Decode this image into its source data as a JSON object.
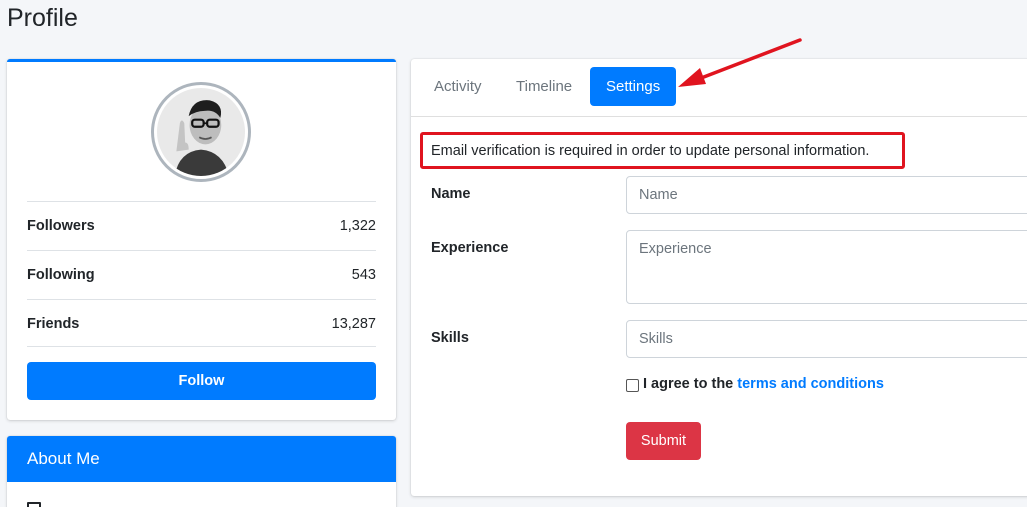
{
  "page": {
    "title": "Profile"
  },
  "profile": {
    "stats": [
      {
        "label": "Followers",
        "value": "1,322"
      },
      {
        "label": "Following",
        "value": "543"
      },
      {
        "label": "Friends",
        "value": "13,287"
      }
    ],
    "follow_label": "Follow"
  },
  "about": {
    "title": "About Me"
  },
  "tabs": [
    {
      "label": "Activity",
      "active": false
    },
    {
      "label": "Timeline",
      "active": false
    },
    {
      "label": "Settings",
      "active": true
    }
  ],
  "notice": "Email verification is required in order to update personal information.",
  "form": {
    "name": {
      "label": "Name",
      "placeholder": "Name"
    },
    "experience": {
      "label": "Experience",
      "placeholder": "Experience"
    },
    "skills": {
      "label": "Skills",
      "placeholder": "Skills"
    },
    "agree_prefix": "I agree to the",
    "agree_link": "terms and conditions",
    "submit_label": "Submit"
  },
  "colors": {
    "primary": "#007bff",
    "danger": "#dc3545",
    "annotation": "#e0141f"
  }
}
